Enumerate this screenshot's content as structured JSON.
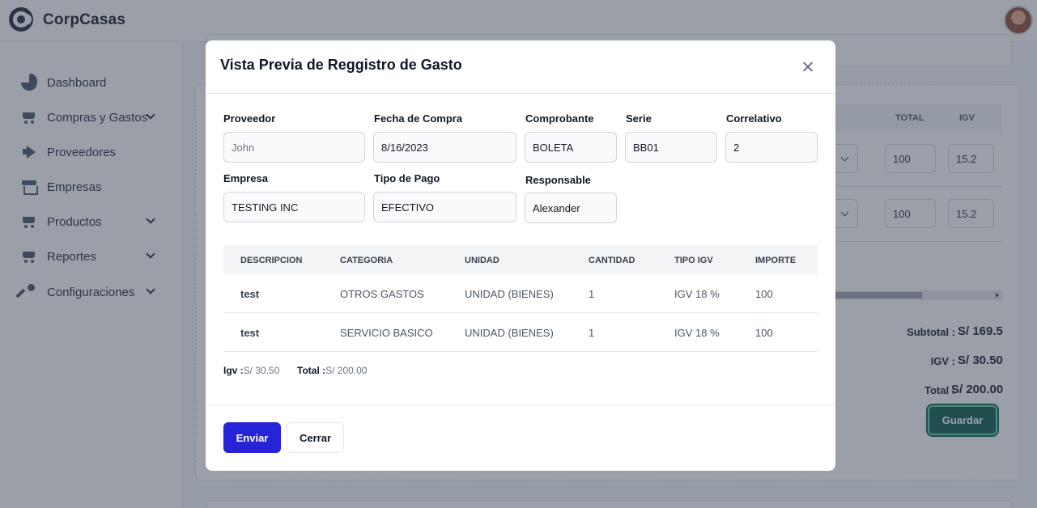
{
  "app": {
    "brand": "CorpCasas"
  },
  "sidebar": {
    "items": [
      {
        "label": "Dashboard",
        "icon": "pie-chart-icon",
        "expandable": false
      },
      {
        "label": "Compras y Gastos",
        "icon": "cart-icon",
        "expandable": true
      },
      {
        "label": "Proveedores",
        "icon": "megaphone-icon",
        "expandable": false
      },
      {
        "label": "Empresas",
        "icon": "store-icon",
        "expandable": false
      },
      {
        "label": "Productos",
        "icon": "cart-icon",
        "expandable": true
      },
      {
        "label": "Reportes",
        "icon": "cart-icon",
        "expandable": true
      },
      {
        "label": "Configuraciones",
        "icon": "wrench-icon",
        "expandable": true
      }
    ]
  },
  "background": {
    "table_headers": {
      "total": "TOTAL",
      "igv": "IGV"
    },
    "rows": [
      {
        "total": "100",
        "igv": "15.2"
      },
      {
        "total": "100",
        "igv": "15.2"
      }
    ],
    "summary": {
      "subtotal_label": "Subtotal :",
      "subtotal_value": "S/ 169.5",
      "igv_label": "IGV :",
      "igv_value": "S/ 30.50",
      "total_label": "Total :",
      "total_value": "S/ 200.00"
    },
    "save_label": "Guardar"
  },
  "modal": {
    "title": "Vista Previa de Reggistro de Gasto",
    "fields": {
      "proveedor": {
        "label": "Proveedor",
        "value": "",
        "placeholder": "John"
      },
      "fecha": {
        "label": "Fecha de Compra",
        "value": "8/16/2023"
      },
      "comprobante": {
        "label": "Comprobante",
        "value": "BOLETA"
      },
      "serie": {
        "label": "Serie",
        "value": "BB01"
      },
      "correlativo": {
        "label": "Correlativo",
        "value": "2"
      },
      "empresa": {
        "label": "Empresa",
        "value": "TESTING INC"
      },
      "tipo_pago": {
        "label": "Tipo de Pago",
        "value": "EFECTIVO"
      },
      "responsable": {
        "label": "Responsable",
        "value": "Alexander"
      }
    },
    "table": {
      "headers": [
        "DESCRIPCION",
        "CATEGORIA",
        "UNIDAD",
        "CANTIDAD",
        "TIPO IGV",
        "IMPORTE"
      ],
      "rows": [
        [
          "test",
          "OTROS GASTOS",
          "UNIDAD (BIENES)",
          "1",
          "IGV 18 %",
          "100"
        ],
        [
          "test",
          "SERVICIO BASICO",
          "UNIDAD (BIENES)",
          "1",
          "IGV 18 %",
          "100"
        ]
      ]
    },
    "totals": {
      "igv_label": "Igv :",
      "igv_value": "S/ 30.50",
      "total_label": "Total :",
      "total_value": "S/ 200.00"
    },
    "buttons": {
      "send": "Enviar",
      "close": "Cerrar"
    }
  },
  "colors": {
    "primary": "#2624d6",
    "save_button": "#0b5c4e",
    "overlay": "#374151"
  }
}
